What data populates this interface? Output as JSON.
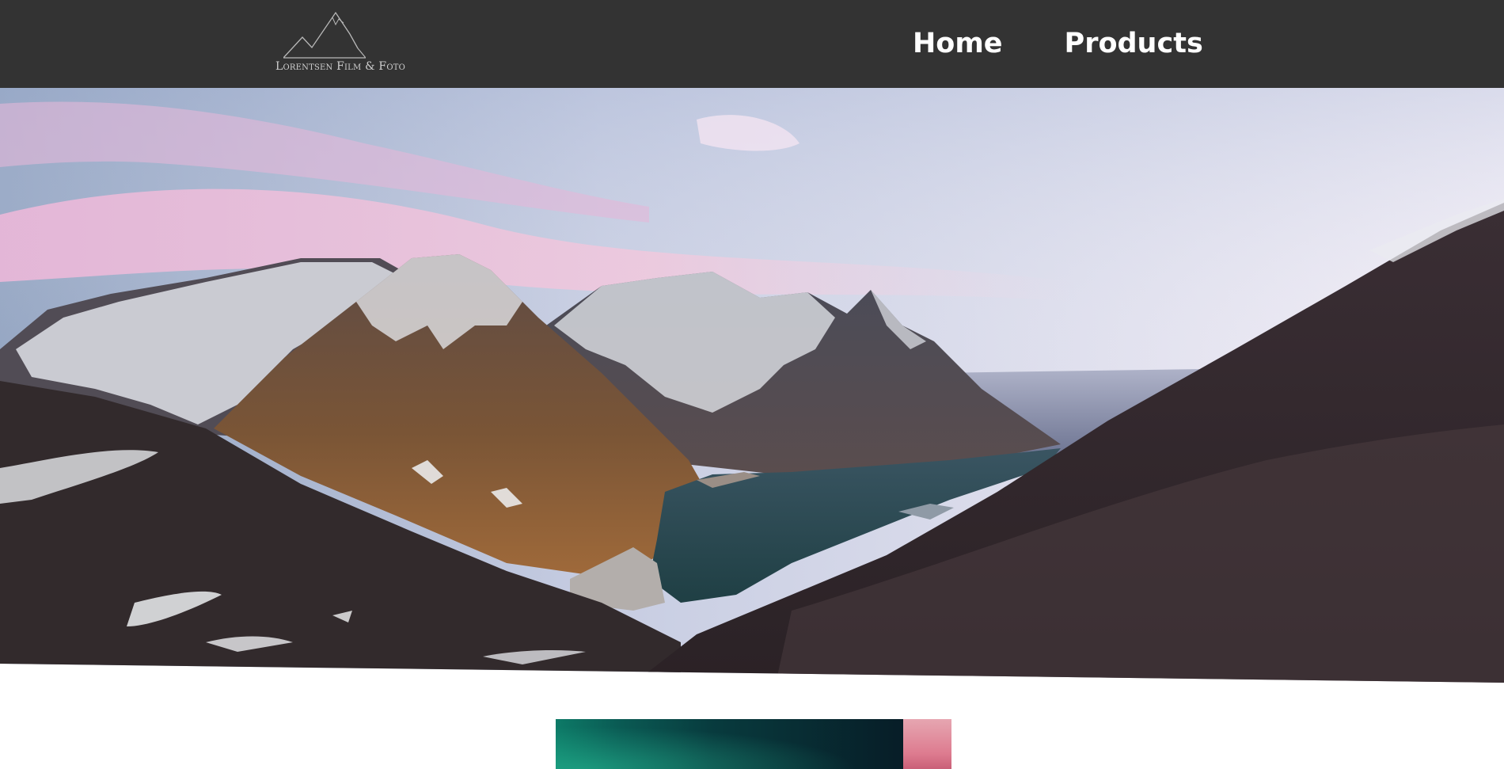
{
  "nav": {
    "logo": {
      "text": "Lorentsen Film & Foto",
      "icon": "mountain-logo-icon"
    },
    "links": [
      {
        "label": "Home"
      },
      {
        "label": "Products"
      }
    ]
  },
  "hero": {
    "image": "mountain-fjord-landscape"
  },
  "gallery": {
    "thumbnails": [
      {
        "image": "aurora-sky"
      },
      {
        "image": "pink-sunset"
      }
    ]
  },
  "colors": {
    "navbar_background": "#333333",
    "nav_text": "#ffffff",
    "logo_text": "#cfcfcf",
    "page_background": "#ffffff"
  }
}
